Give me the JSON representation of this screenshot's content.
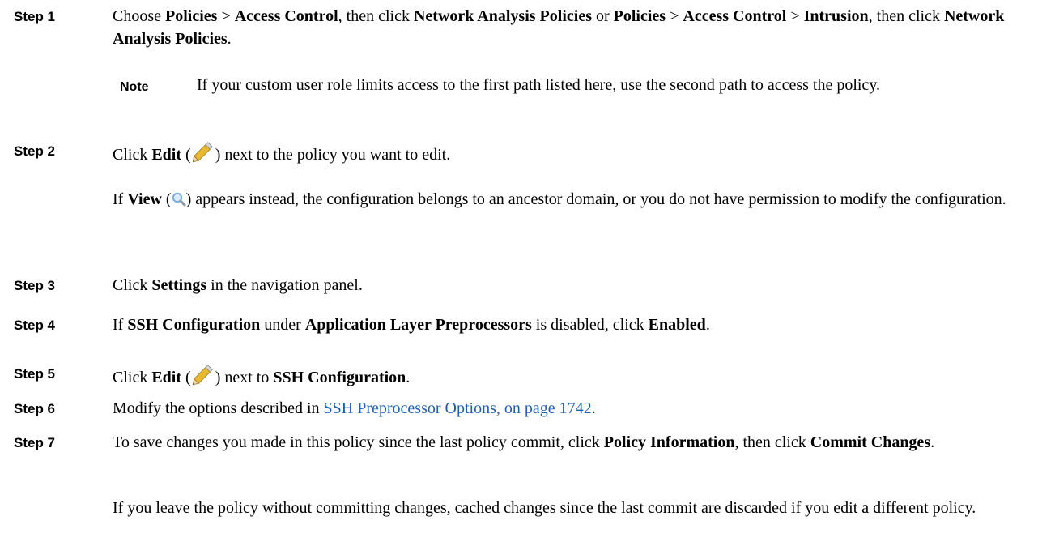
{
  "steps": [
    {
      "label": "Step 1",
      "text": [
        {
          "t": "Choose "
        },
        {
          "b": "Policies"
        },
        {
          "t": " > "
        },
        {
          "b": "Access Control"
        },
        {
          "t": ", then click "
        },
        {
          "b": "Network Analysis Policies"
        },
        {
          "t": " or "
        },
        {
          "b": "Policies"
        },
        {
          "t": "  > "
        },
        {
          "b": "Access Control"
        },
        {
          "t": " > "
        },
        {
          "b": "Intrusion"
        },
        {
          "t": ", then click "
        },
        {
          "b": "Network Analysis Policies"
        },
        {
          "t": "."
        }
      ],
      "note": {
        "label": "Note",
        "text": "If your custom user role limits access to the first path listed here, use the second path to access the policy."
      }
    },
    {
      "label": "Step 2",
      "text": [
        {
          "t": "Click "
        },
        {
          "b": "Edit"
        },
        {
          "t": " ("
        },
        {
          "icon": "pencil-icon"
        },
        {
          "t": ") next to the policy you want to edit."
        }
      ],
      "extra": [
        {
          "t": "If "
        },
        {
          "b": "View"
        },
        {
          "t": " ("
        },
        {
          "icon": "magnifier-icon"
        },
        {
          "t": ") appears instead, the configuration belongs to an ancestor domain, or you do not have permission to modify the configuration."
        }
      ]
    },
    {
      "label": "Step 3",
      "text": [
        {
          "t": "Click "
        },
        {
          "b": "Settings"
        },
        {
          "t": " in the navigation panel."
        }
      ]
    },
    {
      "label": "Step 4",
      "text": [
        {
          "t": "If "
        },
        {
          "b": "SSH Configuration"
        },
        {
          "t": " under "
        },
        {
          "b": "Application Layer Preprocessors"
        },
        {
          "t": " is disabled, click "
        },
        {
          "b": "Enabled"
        },
        {
          "t": "."
        }
      ]
    },
    {
      "label": "Step 5",
      "text": [
        {
          "t": "Click "
        },
        {
          "b": "Edit"
        },
        {
          "t": " ("
        },
        {
          "icon": "pencil-icon"
        },
        {
          "t": ") next to "
        },
        {
          "b": "SSH Configuration"
        },
        {
          "t": "."
        }
      ]
    },
    {
      "label": "Step 6",
      "text": [
        {
          "t": "Modify the options described in "
        },
        {
          "link": "SSH Preprocessor Options, on page 1742"
        },
        {
          "t": "."
        }
      ]
    },
    {
      "label": "Step 7",
      "text": [
        {
          "t": "To save changes you made in this policy since the last policy commit, click "
        },
        {
          "b": "Policy Information"
        },
        {
          "t": ", then click "
        },
        {
          "b": "Commit Changes"
        },
        {
          "t": "."
        }
      ],
      "extra": [
        {
          "t": "If you leave the policy without committing changes, cached changes since the last commit are discarded if you edit a different policy."
        }
      ]
    }
  ],
  "colors": {
    "link": "#1f5fb0",
    "pencil": "#e8b830",
    "magnifier": "#7aaee0"
  }
}
